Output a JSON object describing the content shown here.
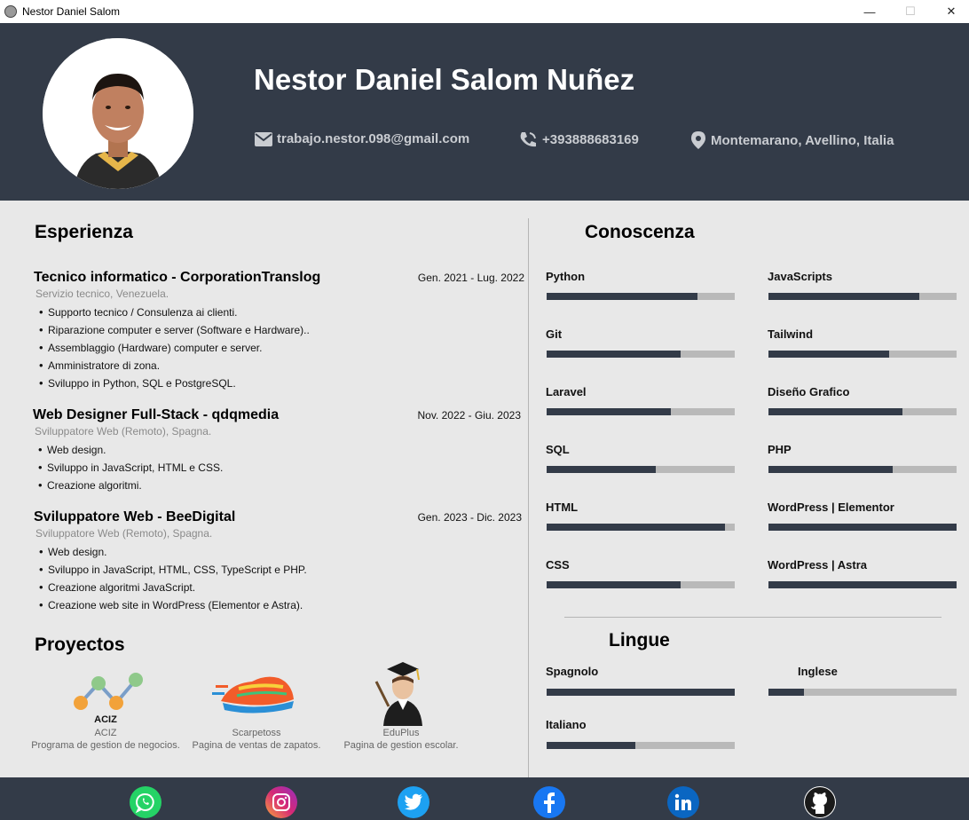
{
  "window": {
    "title": "Nestor Daniel Salom",
    "minimize_glyph": "—",
    "maximize_glyph": "☐",
    "close_glyph": "✕"
  },
  "header": {
    "name": "Nestor Daniel Salom Nuñez",
    "email": "trabajo.nestor.098@gmail.com",
    "phone": "+393888683169",
    "location": "Montemarano, Avellino, Italia"
  },
  "experience": {
    "title": "Esperienza",
    "jobs": [
      {
        "title": "Tecnico informatico - CorporationTranslog",
        "date": "Gen. 2021 - Lug. 2022",
        "subtitle": "Servizio tecnico, Venezuela.",
        "bullets": [
          "Supporto tecnico / Consulenza ai clienti.",
          "Riparazione computer e server (Software e Hardware)..",
          "Assemblaggio (Hardware) computer e server.",
          "Amministratore di zona.",
          "Sviluppo in Python, SQL e PostgreSQL."
        ]
      },
      {
        "title": "Web Designer Full-Stack - qdqmedia",
        "date": "Nov. 2022 - Giu. 2023",
        "subtitle": "Sviluppatore Web (Remoto), Spagna.",
        "bullets": [
          "Web design.",
          "Sviluppo in JavaScript, HTML e CSS.",
          "Creazione algoritmi."
        ]
      },
      {
        "title": "Sviluppatore Web - BeeDigital",
        "date": "Gen. 2023 - Dic. 2023",
        "subtitle": "Sviluppatore Web (Remoto), Spagna.",
        "bullets": [
          "Web design.",
          "Sviluppo in JavaScript, HTML, CSS, TypeScript e PHP.",
          "Creazione algoritmi JavaScript.",
          "Creazione web site in WordPress (Elementor e Astra)."
        ]
      }
    ]
  },
  "projects": {
    "title": "Proyectos",
    "items": [
      {
        "name": "ACIZ",
        "logo_text": "ACIZ",
        "description": "Programa de gestion de negocios.",
        "icon": "chart-logo"
      },
      {
        "name": "Scarpetoss",
        "description": "Pagina de ventas de zapatos.",
        "icon": "sneaker-logo"
      },
      {
        "name": "EduPlus",
        "description": "Pagina de gestion escolar.",
        "icon": "graduate-logo"
      }
    ]
  },
  "skills": {
    "title": "Conoscenza",
    "items": [
      {
        "name": "Python",
        "level": 0.8
      },
      {
        "name": "JavaScripts",
        "level": 0.8
      },
      {
        "name": "Git",
        "level": 0.71
      },
      {
        "name": "Tailwind",
        "level": 0.64
      },
      {
        "name": "Laravel",
        "level": 0.66
      },
      {
        "name": "Diseño Grafico",
        "level": 0.71
      },
      {
        "name": "SQL",
        "level": 0.58
      },
      {
        "name": "PHP",
        "level": 0.66
      },
      {
        "name": "HTML",
        "level": 0.95
      },
      {
        "name": "WordPress | Elementor",
        "level": 1.0
      },
      {
        "name": "CSS",
        "level": 0.71
      },
      {
        "name": "WordPress | Astra",
        "level": 1.0
      }
    ]
  },
  "languages": {
    "title": "Lingue",
    "items": [
      {
        "name": "Spagnolo",
        "level": 1.0
      },
      {
        "name": "Inglese",
        "level": 0.19
      },
      {
        "name": "Italiano",
        "level": 0.47
      }
    ]
  },
  "footer": {
    "social": [
      {
        "name": "whatsapp",
        "color": "#25d366"
      },
      {
        "name": "instagram",
        "color": "#d62976"
      },
      {
        "name": "twitter",
        "color": "#1da1f2"
      },
      {
        "name": "facebook",
        "color": "#1877f2"
      },
      {
        "name": "linkedin",
        "color": "#0a66c2"
      },
      {
        "name": "github",
        "color": "#ffffff"
      }
    ]
  },
  "colors": {
    "header_bg": "#333b48",
    "page_bg": "#e8e8e8",
    "bar_track": "#b9b9b9",
    "bar_fill": "#333b48"
  }
}
